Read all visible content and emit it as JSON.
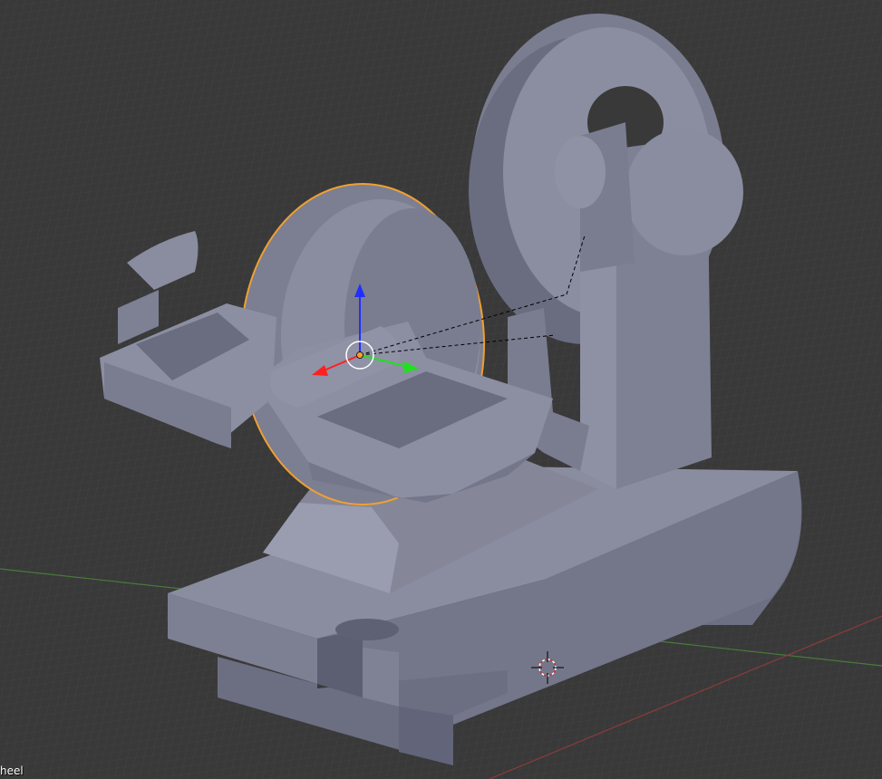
{
  "viewport": {
    "object_name": "heel",
    "background_color": "#393939",
    "grid_color": "#454545",
    "x_axis_color": "#8c3b3b",
    "y_axis_color": "#4a7a3a",
    "mesh_color": "#7d7f93",
    "selection_outline_color": "#f0a030"
  },
  "gizmo": {
    "x_arrow_color": "#ff2020",
    "y_arrow_color": "#20e020",
    "z_arrow_color": "#2030ff"
  },
  "icons": {
    "origin": "object-origin-icon",
    "cursor": "3d-cursor-icon"
  }
}
